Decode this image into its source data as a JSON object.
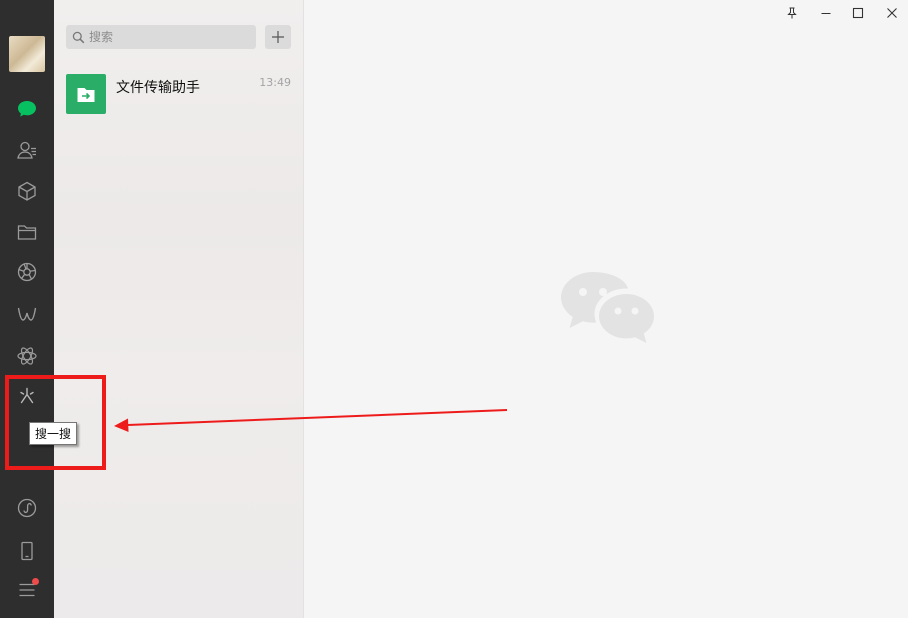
{
  "search": {
    "placeholder": "搜索"
  },
  "chat_list": [
    {
      "name": "文件传输助手",
      "time": "13:49"
    }
  ],
  "tooltip": {
    "text": "搜一搜"
  },
  "colors": {
    "sidebar": "#2e2e2e",
    "chat_icon_active": "#07c160",
    "file_transfer": "#2aae67",
    "annotation": "#ee1b1b"
  },
  "icons": {
    "sidebar": [
      "chat-icon",
      "contacts-icon",
      "favorites-icon",
      "files-icon",
      "moments-icon",
      "channels-icon",
      "mini-programs-icon",
      "search-sparkle-icon",
      "mini-program-panel-icon",
      "phone-icon",
      "menu-icon"
    ]
  }
}
